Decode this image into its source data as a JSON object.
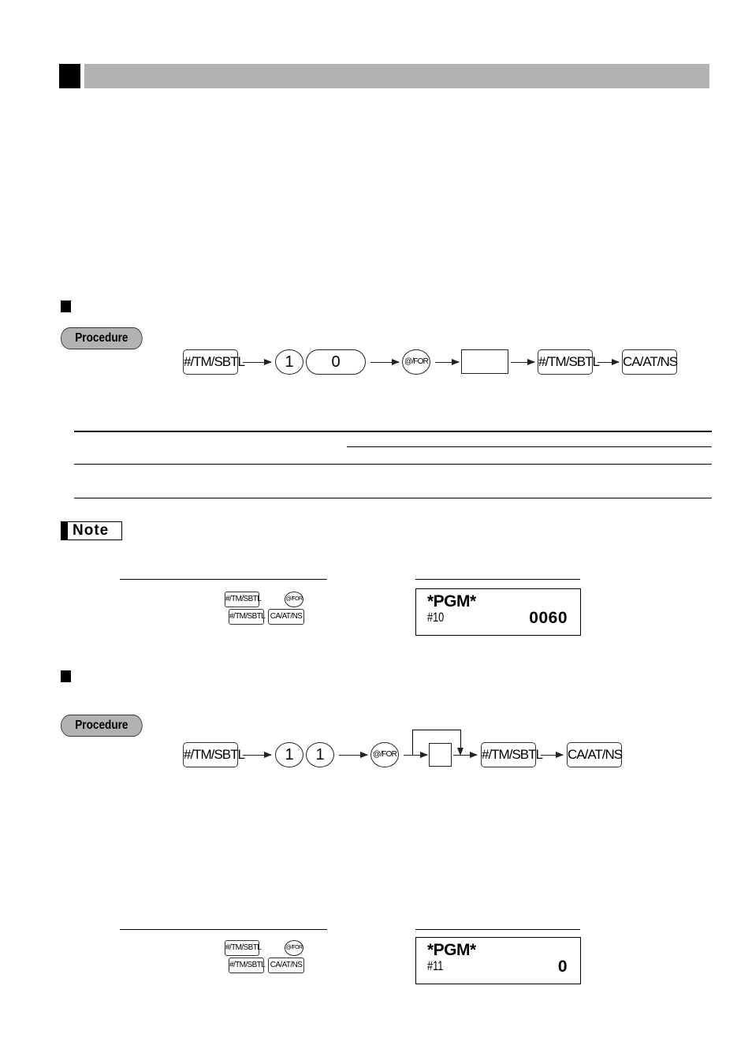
{
  "section": {
    "header_title": ""
  },
  "subsection1": {
    "procedure_label": "Procedure",
    "sequence": {
      "key1": "#/TM/SBTL",
      "digit1": "1",
      "digit2": "0",
      "at_for": "@/FOR",
      "input_box": "",
      "key2": "#/TM/SBTL",
      "key3": "CA/AT/NS"
    }
  },
  "note": {
    "label": "Note",
    "example_keys": {
      "row1": [
        "#/TM/SBTL",
        "@/FOR"
      ],
      "row2": [
        "#/TM/SBTL",
        "CA/AT/NS"
      ]
    },
    "printout": {
      "title": "*PGM*",
      "code": "#10",
      "value": "0060"
    }
  },
  "subsection2": {
    "procedure_label": "Procedure",
    "sequence": {
      "key1": "#/TM/SBTL",
      "digit1": "1",
      "digit2": "1",
      "at_for": "@/FOR",
      "input_box": "",
      "key2": "#/TM/SBTL",
      "key3": "CA/AT/NS"
    },
    "example_keys": {
      "row1": [
        "#/TM/SBTL",
        "@/FOR"
      ],
      "row2": [
        "#/TM/SBTL",
        "CA/AT/NS"
      ]
    },
    "printout": {
      "title": "*PGM*",
      "code": "#11",
      "value": "0"
    }
  }
}
